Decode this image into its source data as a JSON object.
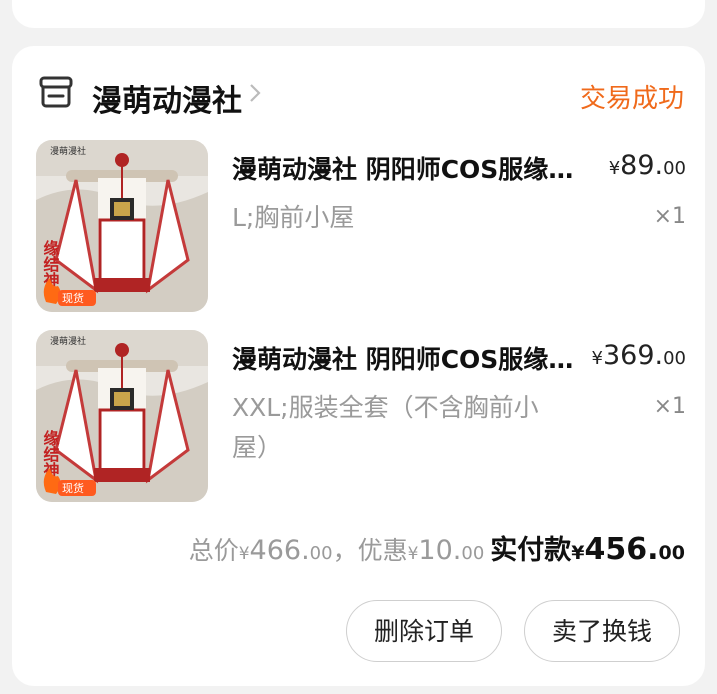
{
  "shop": {
    "name": "漫萌动漫社",
    "status": "交易成功"
  },
  "items": [
    {
      "title": "漫萌动漫社 阴阳师COS服缘结神cos服缘结...",
      "spec": "L;胸前小屋",
      "price_currency": "¥",
      "price_int": "89.",
      "price_dec": "00",
      "qty": "×1",
      "thumb_badge": "现货",
      "thumb_side_text": "缘结神",
      "thumb_top_text": "漫萌漫社"
    },
    {
      "title": "漫萌动漫社 阴阳师COS服缘结神cos服...",
      "spec": "XXL;服装全套（不含胸前小屋）",
      "price_currency": "¥",
      "price_int": "369.",
      "price_dec": "00",
      "qty": "×1",
      "thumb_badge": "现货",
      "thumb_side_text": "缘结神",
      "thumb_top_text": "漫萌漫社"
    }
  ],
  "summary": {
    "total_label": "总价",
    "total_currency": "¥",
    "total_int": "466.",
    "total_dec": "00",
    "separator": "，",
    "discount_label": "优惠",
    "discount_currency": "¥",
    "discount_int": "10.",
    "discount_dec": "00",
    "paid_label": "实付款",
    "paid_currency": "¥",
    "paid_int": "456.",
    "paid_dec": "00"
  },
  "actions": {
    "delete_label": "删除订单",
    "sell_label": "卖了换钱"
  },
  "colors": {
    "accent": "#f06a1b",
    "card": "#ffffff",
    "background": "#f2f2f2"
  },
  "icons": {
    "shop": "store-icon",
    "chevron": "chevron-right-icon"
  }
}
